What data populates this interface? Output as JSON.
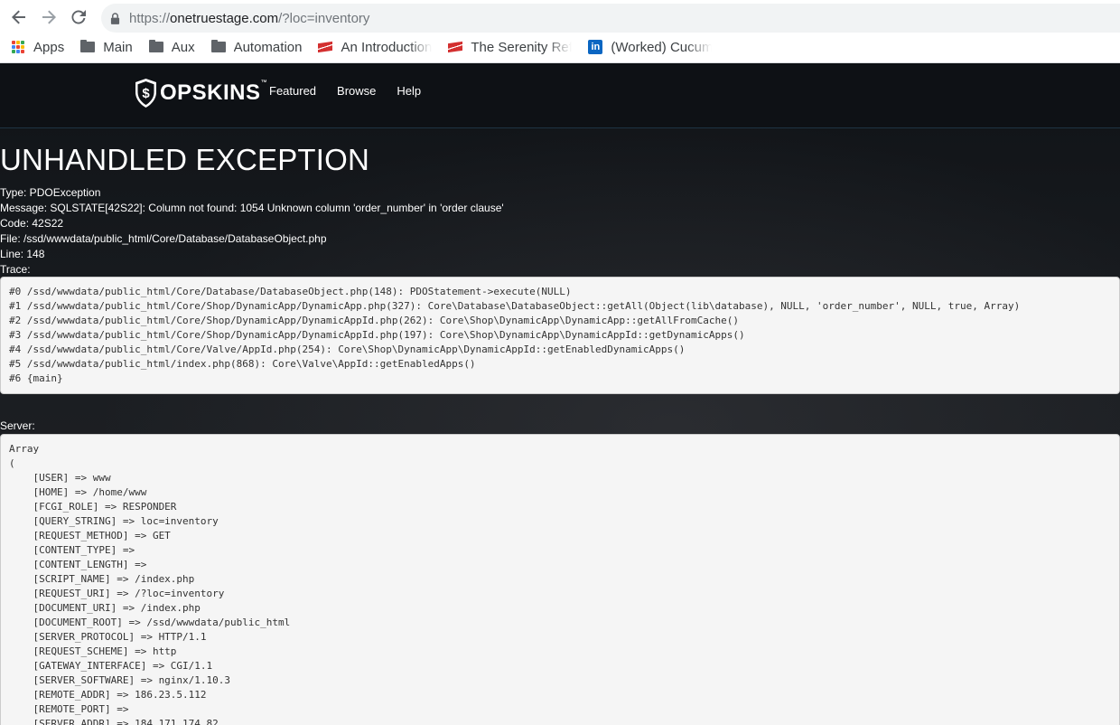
{
  "browser": {
    "url_host": "onetruestage.com",
    "url_path": "/?loc=inventory",
    "url_scheme": "https://",
    "bookmarks": [
      {
        "label": "Apps",
        "icon": "apps-grid-icon"
      },
      {
        "label": "Main",
        "icon": "folder-icon"
      },
      {
        "label": "Aux",
        "icon": "folder-icon"
      },
      {
        "label": "Automation",
        "icon": "folder-icon"
      },
      {
        "label": "An Introduction",
        "icon": "flag-icon"
      },
      {
        "label": "The Serenity Ref",
        "icon": "flag-icon"
      },
      {
        "label": "(Worked) Cucum",
        "icon": "linkedin-icon"
      }
    ]
  },
  "site": {
    "logo_text": "OPSKINS",
    "logo_tm": "™",
    "nav": [
      "Featured",
      "Browse",
      "Help"
    ]
  },
  "error": {
    "title": "UNHANDLED EXCEPTION",
    "type": "Type: PDOException",
    "message": "Message: SQLSTATE[42S22]: Column not found: 1054 Unknown column 'order_number' in 'order clause'",
    "code": "Code: 42S22",
    "file": "File: /ssd/wwwdata/public_html/Core/Database/DatabaseObject.php",
    "line": "Line: 148",
    "trace_label": "Trace:",
    "trace": [
      "#0 /ssd/wwwdata/public_html/Core/Database/DatabaseObject.php(148): PDOStatement->execute(NULL)",
      "#1 /ssd/wwwdata/public_html/Core/Shop/DynamicApp/DynamicApp.php(327): Core\\Database\\DatabaseObject::getAll(Object(lib\\database), NULL, 'order_number', NULL, true, Array)",
      "#2 /ssd/wwwdata/public_html/Core/Shop/DynamicApp/DynamicAppId.php(262): Core\\Shop\\DynamicApp\\DynamicApp::getAllFromCache()",
      "#3 /ssd/wwwdata/public_html/Core/Shop/DynamicApp/DynamicAppId.php(197): Core\\Shop\\DynamicApp\\DynamicAppId::getDynamicApps()",
      "#4 /ssd/wwwdata/public_html/Core/Valve/AppId.php(254): Core\\Shop\\DynamicApp\\DynamicAppId::getEnabledDynamicApps()",
      "#5 /ssd/wwwdata/public_html/index.php(868): Core\\Valve\\AppId::getEnabledApps()",
      "#6 {main}"
    ],
    "server_label": "Server:",
    "server_lines": [
      "Array",
      "(",
      "    [USER] => www",
      "    [HOME] => /home/www",
      "    [FCGI_ROLE] => RESPONDER",
      "    [QUERY_STRING] => loc=inventory",
      "    [REQUEST_METHOD] => GET",
      "    [CONTENT_TYPE] =>",
      "    [CONTENT_LENGTH] =>",
      "    [SCRIPT_NAME] => /index.php",
      "    [REQUEST_URI] => /?loc=inventory",
      "    [DOCUMENT_URI] => /index.php",
      "    [DOCUMENT_ROOT] => /ssd/wwwdata/public_html",
      "    [SERVER_PROTOCOL] => HTTP/1.1",
      "    [REQUEST_SCHEME] => http",
      "    [GATEWAY_INTERFACE] => CGI/1.1",
      "    [SERVER_SOFTWARE] => nginx/1.10.3",
      "    [REMOTE_ADDR] => 186.23.5.112",
      "    [REMOTE_PORT] =>",
      "    [SERVER_ADDR] => 184.171.174.82"
    ]
  },
  "colors": {
    "header_bg": "#0e1115",
    "code_bg": "#f5f5f5",
    "linkedin": "#0a66c2"
  }
}
